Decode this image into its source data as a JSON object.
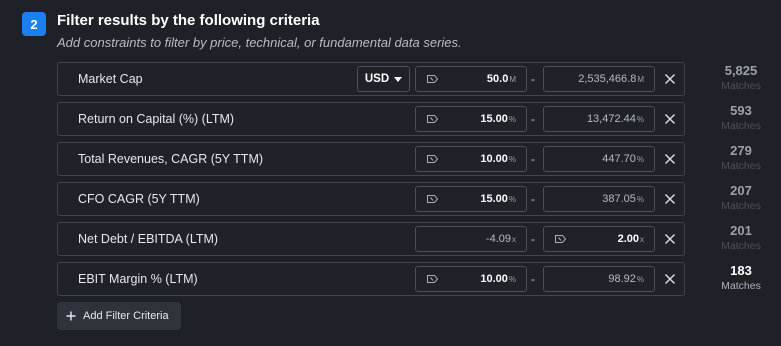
{
  "section": {
    "step": "2",
    "title": "Filter results by the following criteria",
    "subtitle": "Add constraints to filter by price, technical, or fundamental data series."
  },
  "rows": [
    {
      "label": "Market Cap",
      "currency": "USD",
      "min": {
        "value": "50.0",
        "unit": "M"
      },
      "max": {
        "value": "2,535,466.8",
        "unit": "M"
      },
      "matches": "5,825"
    },
    {
      "label": "Return on Capital (%) (LTM)",
      "min": {
        "value": "15.00",
        "unit": "%"
      },
      "max": {
        "value": "13,472.44",
        "unit": "%"
      },
      "matches": "593"
    },
    {
      "label": "Total Revenues, CAGR (5Y TTM)",
      "min": {
        "value": "10.00",
        "unit": "%"
      },
      "max": {
        "value": "447.70",
        "unit": "%"
      },
      "matches": "279"
    },
    {
      "label": "CFO CAGR (5Y TTM)",
      "min": {
        "value": "15.00",
        "unit": "%"
      },
      "max": {
        "value": "387.05",
        "unit": "%"
      },
      "matches": "207"
    },
    {
      "label": "Net Debt / EBITDA (LTM)",
      "min": {
        "value": "-4.09",
        "unit": "x"
      },
      "max": {
        "value": "2.00",
        "unit": "x"
      },
      "matches": "201"
    },
    {
      "label": "EBIT Margin % (LTM)",
      "min": {
        "value": "10.00",
        "unit": "%"
      },
      "max": {
        "value": "98.92",
        "unit": "%"
      },
      "matches": "183"
    }
  ],
  "matches_label": "Matches",
  "add_button": {
    "label": "Add Filter Criteria"
  },
  "colors": {
    "background": "#1e2128",
    "accent": "#1c7ff0",
    "border": "#3f444f"
  },
  "icons": {
    "set_value": "tag-icon",
    "remove": "close-icon",
    "add": "plus-icon",
    "dropdown": "chevron-down-icon"
  }
}
